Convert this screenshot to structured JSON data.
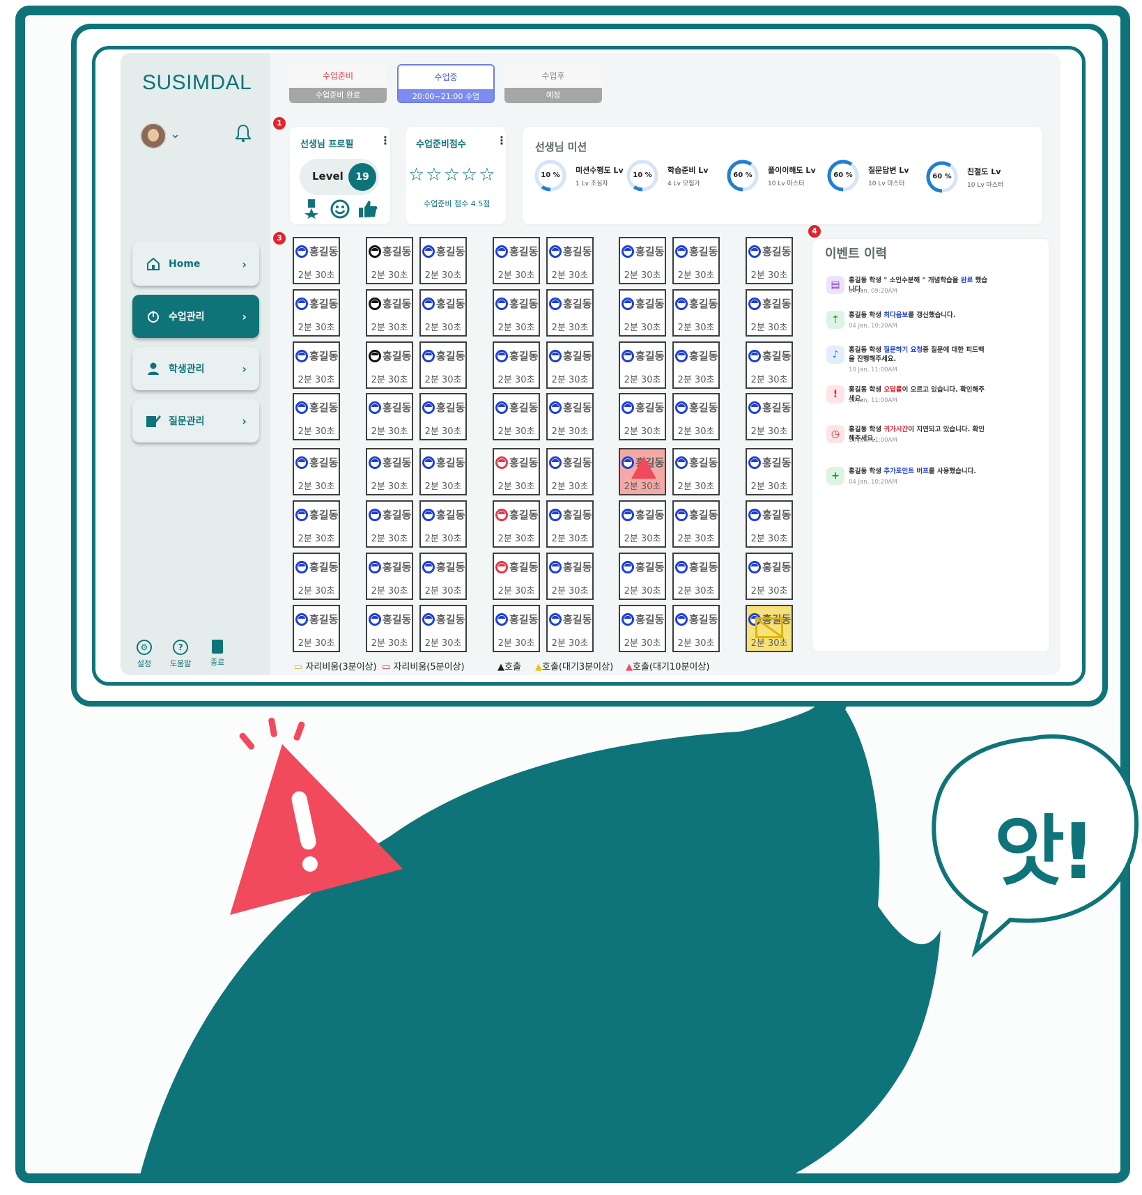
{
  "app": {
    "logo": "SUSIMDAL"
  },
  "sidebar": {
    "items": [
      {
        "label": "Home",
        "icon": "home-icon",
        "active": false
      },
      {
        "label": "수업관리",
        "icon": "power-icon",
        "active": true
      },
      {
        "label": "학생관리",
        "icon": "person-icon",
        "active": false
      },
      {
        "label": "질문관리",
        "icon": "edit-icon",
        "active": false
      }
    ],
    "bottom": [
      {
        "label": "설정",
        "icon": "gear-icon"
      },
      {
        "label": "도움말",
        "icon": "help-icon"
      },
      {
        "label": "종료",
        "icon": "exit-icon"
      }
    ]
  },
  "tabs": [
    {
      "title": "수업준비",
      "sub": "수업준비 완료",
      "state": "done"
    },
    {
      "title": "수업중",
      "sub": "20:00~21:00 수업",
      "state": "active"
    },
    {
      "title": "수업후",
      "sub": "예정",
      "state": "pending"
    }
  ],
  "badges": [
    "1",
    "2",
    "3",
    "4"
  ],
  "profile": {
    "title": "선생님 프로필",
    "level_label": "Level",
    "level": "19"
  },
  "prep_score": {
    "title": "수업준비점수",
    "stars": "☆☆☆☆☆",
    "text": "수업준비 점수 4.5점"
  },
  "missions": {
    "title": "선생님 미션",
    "items": [
      {
        "name": "미션수행도 Lv",
        "sub": "1 Lv 초심자",
        "percent": "10 %",
        "value": 10
      },
      {
        "name": "학습준비 Lv",
        "sub": "4 Lv 모험가",
        "percent": "10 %",
        "value": 10
      },
      {
        "name": "풀이이해도 Lv",
        "sub": "10 Lv 마스터",
        "percent": "60 %",
        "value": 60
      },
      {
        "name": "질문답변 Lv",
        "sub": "10 Lv 마스터",
        "percent": "60 %",
        "value": 60
      },
      {
        "name": "친절도 Lv",
        "sub": "10 Lv 마스터",
        "percent": "60 %",
        "value": 60
      }
    ]
  },
  "seats": {
    "name": "홍길동",
    "time": "2분 30초",
    "columns": [
      {
        "faces": [
          "b",
          "b",
          "b",
          "b",
          "b",
          "b",
          "b",
          "b"
        ]
      },
      {
        "faces": [
          "k",
          "k",
          "k",
          "b",
          "b",
          "b",
          "b",
          "b"
        ]
      },
      {
        "faces": [
          "b",
          "b",
          "b",
          "b",
          "b",
          "b",
          "b",
          "b"
        ]
      },
      {
        "faces": [
          "b",
          "b",
          "b",
          "b",
          "r",
          "r",
          "r",
          "b"
        ]
      },
      {
        "faces": [
          "b",
          "b",
          "b",
          "b",
          "b",
          "b",
          "b",
          "b"
        ]
      },
      {
        "faces": [
          "b",
          "b",
          "b",
          "b",
          "b",
          "b",
          "b",
          "b"
        ]
      },
      {
        "faces": [
          "b",
          "b",
          "b",
          "b",
          "b",
          "b",
          "b",
          "b"
        ]
      },
      {
        "faces": [
          "b",
          "b",
          "b",
          "b",
          "b",
          "b",
          "b",
          "b"
        ]
      }
    ],
    "alert_seat": {
      "col": 5,
      "row": 4
    },
    "away_seat": {
      "col": 7,
      "row": 7
    }
  },
  "legend": [
    {
      "label": "자리비움(3분이상)",
      "icon": "away-yellow-icon"
    },
    {
      "label": "자리비움(5분이상)",
      "icon": "away-red-icon"
    },
    {
      "label": "호출",
      "icon": "call-black-icon"
    },
    {
      "label": "호출(대기3분이상)",
      "icon": "call-yellow-icon"
    },
    {
      "label": "호출(대기10분이상)",
      "icon": "call-red-icon"
    }
  ],
  "events": {
    "title": "이벤트 이력",
    "items": [
      {
        "icon": "clipboard-icon",
        "pre": "홍길동 학생 \" 소인수분해 \" 개념학습을 ",
        "hl": "완료",
        "post": " 했습니다.",
        "hl_color": "blue",
        "date": "04 Jan, 09:20AM"
      },
      {
        "icon": "sort-up-icon",
        "pre": "홍길동 학생 ",
        "hl": "최다음보",
        "post": "를 갱신했습니다.",
        "hl_color": "blue",
        "date": "04 Jan, 10:20AM"
      },
      {
        "icon": "mic-icon",
        "pre": "홍길동 학생 ",
        "hl": "질문하기 요청",
        "post": "중 질문에 대한 피드백을 진행해주세요.",
        "hl_color": "blue",
        "date": "10 Jan, 11:00AM"
      },
      {
        "icon": "alert-icon",
        "pre": "홍길동 학생 ",
        "hl": "오답률",
        "post": "이 오르고 있습니다. 확인해주세요.",
        "hl_color": "red",
        "date": "10 Jan, 11:00AM"
      },
      {
        "icon": "alarm-icon",
        "pre": "홍길동 학생 ",
        "hl": "귀가시간",
        "post": "이 지연되고 있습니다. 확인해주세요.",
        "hl_color": "red",
        "date": "10 Jan, 11:00AM"
      },
      {
        "icon": "chat-plus-icon",
        "pre": "홍길동 학생 ",
        "hl": "추가포인트 버프",
        "post": "를 사용했습니다.",
        "hl_color": "blue",
        "date": "04 Jan, 10:20AM"
      }
    ]
  },
  "exclaim": "앗!",
  "colors": {
    "teal": "#0f7479",
    "warning": "#f14a5d",
    "blue": "#1f3fd6",
    "red": "#e3232d"
  }
}
